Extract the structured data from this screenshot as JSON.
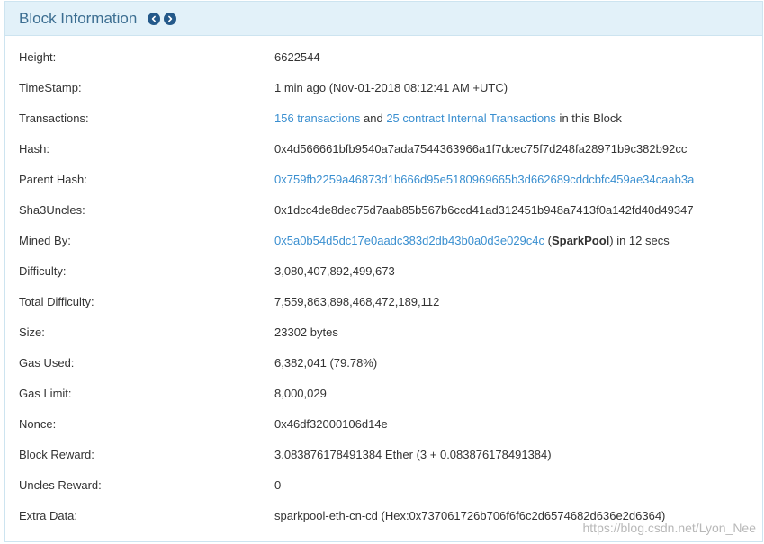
{
  "header": {
    "title": "Block Information",
    "nav_icons": {
      "prev": "chevron-left-circle-icon",
      "next": "chevron-right-circle-icon"
    }
  },
  "rows": [
    {
      "label": "Height:",
      "value": [
        "6622544"
      ]
    },
    {
      "label": "TimeStamp:",
      "value": [
        "1 min ago (Nov-01-2018 08:12:41 AM +UTC)"
      ]
    },
    {
      "label": "Transactions:",
      "value": [
        "156 transactions",
        " and ",
        "25 contract Internal Transactions",
        " in this Block"
      ]
    },
    {
      "label": "Hash:",
      "value": [
        "0x4d566661bfb9540a7ada7544363966a1f7dcec75f7d248fa28971b9c382b92cc"
      ]
    },
    {
      "label": "Parent Hash:",
      "value": [
        "0x759fb2259a46873d1b666d95e5180969665b3d662689cddcbfc459ae34caab3a"
      ]
    },
    {
      "label": "Sha3Uncles:",
      "value": [
        "0x1dcc4de8dec75d7aab85b567b6ccd41ad312451b948a7413f0a142fd40d49347"
      ]
    },
    {
      "label": "Mined By:",
      "value": [
        "0x5a0b54d5dc17e0aadc383d2db43b0a0d3e029c4c",
        " (",
        "SparkPool",
        ") in 12 secs"
      ]
    },
    {
      "label": "Difficulty:",
      "value": [
        "3,080,407,892,499,673"
      ]
    },
    {
      "label": "Total Difficulty:",
      "value": [
        "7,559,863,898,468,472,189,112"
      ]
    },
    {
      "label": "Size:",
      "value": [
        "23302 bytes"
      ]
    },
    {
      "label": "Gas Used:",
      "value": [
        "6,382,041 (79.78%)"
      ]
    },
    {
      "label": "Gas Limit:",
      "value": [
        "8,000,029"
      ]
    },
    {
      "label": "Nonce:",
      "value": [
        "0x46df32000106d14e"
      ]
    },
    {
      "label": "Block Reward:",
      "value": [
        "3.083876178491384 Ether (3 + 0.083876178491384)"
      ]
    },
    {
      "label": "Uncles Reward:",
      "value": [
        "0"
      ]
    },
    {
      "label": "Extra Data:",
      "value": [
        "sparkpool-eth-cn-cd (Hex:0x737061726b706f6f6c2d6574682d636e2d6364)"
      ]
    }
  ],
  "watermark": "https://blog.csdn.net/Lyon_Nee",
  "colors": {
    "header_bg": "#e2f1f9",
    "border": "#cde4f0",
    "title": "#3c6e91",
    "nav_icon": "#24598a",
    "text": "#333333",
    "link": "#3a8fd0",
    "watermark": "#b8b8b8"
  }
}
